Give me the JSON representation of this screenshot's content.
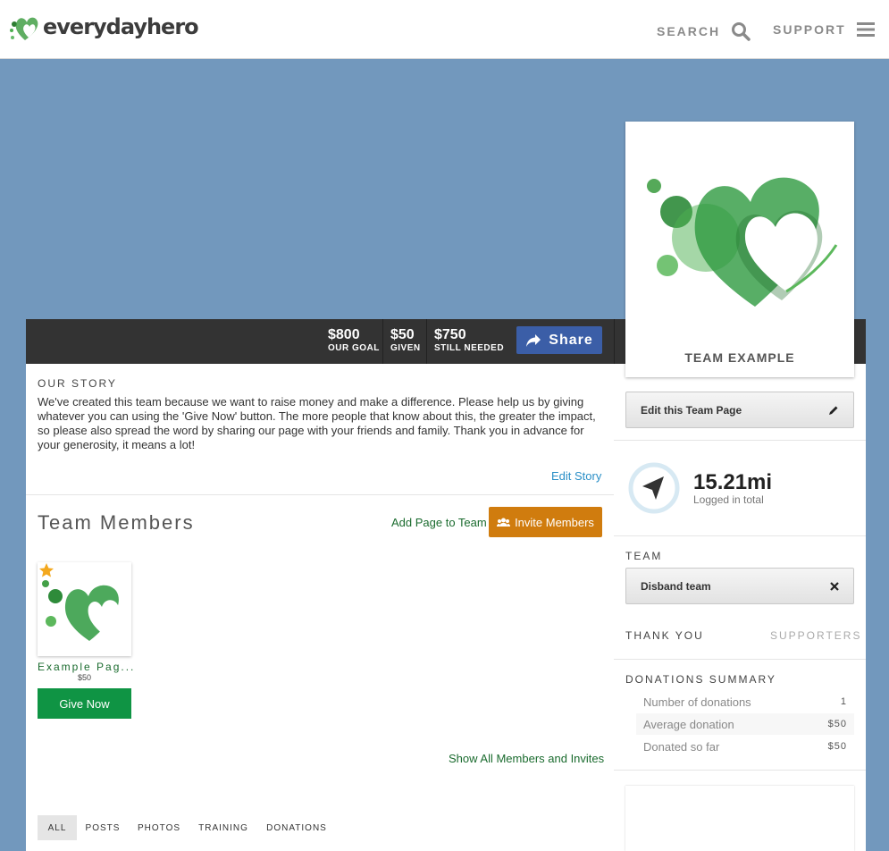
{
  "header": {
    "logo_text": "everydayhero",
    "search_label": "SEARCH",
    "support_label": "SUPPORT"
  },
  "stats": {
    "goal_value": "$800",
    "goal_label": "OUR GOAL",
    "given_value": "$50",
    "given_label": "GIVEN",
    "needed_value": "$750",
    "needed_label": "STILL NEEDED",
    "share_label": "Share"
  },
  "team_card": {
    "title": "TEAM EXAMPLE"
  },
  "story": {
    "heading": "OUR STORY",
    "text": "We've created this team because we want to raise money and make a difference. Please help us by giving whatever you can using the 'Give Now' button. The more people that know about this, the greater the impact, so please also spread the word by sharing our page with your friends and family. Thank you in advance for your generosity, it means a lot!",
    "edit_label": "Edit Story"
  },
  "members": {
    "heading": "Team Members",
    "add_page_label": "Add Page to Team",
    "invite_label": "Invite Members",
    "items": [
      {
        "name": "Example Pag...",
        "amount": "$50",
        "give_label": "Give Now"
      }
    ],
    "show_all_label": "Show All Members and Invites"
  },
  "feed_tabs": [
    "ALL",
    "POSTS",
    "PHOTOS",
    "TRAINING",
    "DONATIONS"
  ],
  "sidebar": {
    "edit_page_label": "Edit this Team Page",
    "distance_value": "15.21mi",
    "distance_label": "Logged in total",
    "team_heading": "TEAM",
    "disband_label": "Disband team",
    "thank_you_label": "THANK YOU",
    "supporters_label": "SUPPORTERS",
    "summary_heading": "DONATIONS SUMMARY",
    "summary": [
      {
        "label": "Number of donations",
        "value": "1"
      },
      {
        "label": "Average donation",
        "value": "$50"
      },
      {
        "label": "Donated so far",
        "value": "$50"
      }
    ]
  },
  "colors": {
    "brand_green": "#0f9444",
    "orange": "#d07c0e",
    "share_blue": "#3b5ea7",
    "banner_blue": "#7298bd"
  }
}
